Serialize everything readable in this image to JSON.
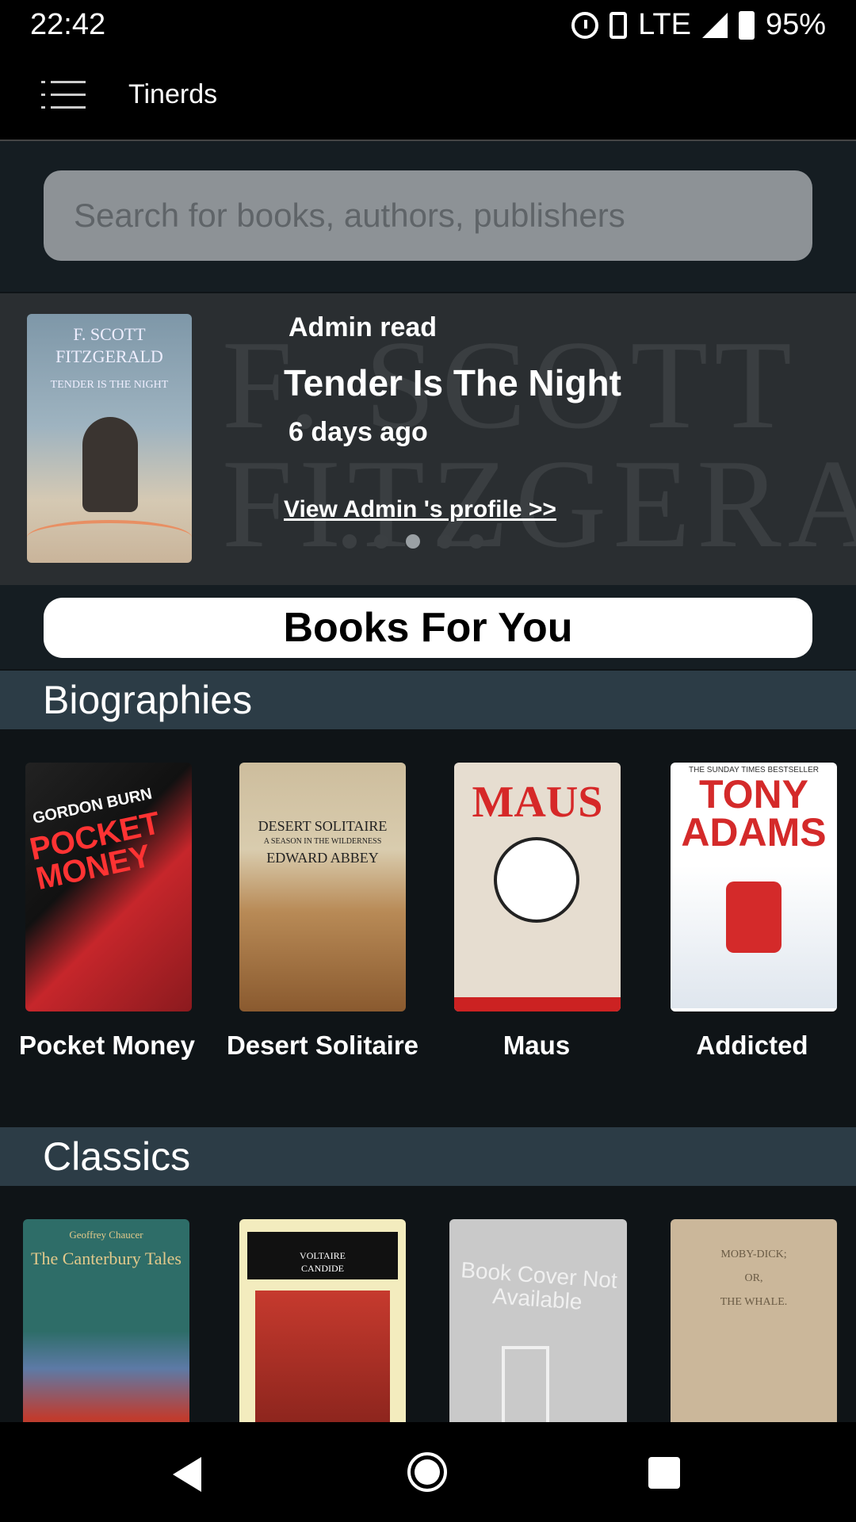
{
  "status_bar": {
    "time": "22:42",
    "network": "LTE",
    "battery": "95%"
  },
  "app_bar": {
    "title": "Tinerds"
  },
  "search": {
    "placeholder": "Search for books, authors, publishers"
  },
  "carousel": {
    "label": "Admin read",
    "title": "Tender Is The Night",
    "time_ago": "6 days ago",
    "profile_link": "View Admin 's profile >>",
    "background_text": "F. SCOTT FITZGERALD",
    "cover_author": "F. SCOTT FITZGERALD",
    "cover_title": "TENDER IS THE NIGHT",
    "dots": 5,
    "active_dot": 3
  },
  "books_for_you": {
    "label": "Books For You"
  },
  "categories": [
    {
      "name": "Biographies",
      "books": [
        {
          "title": "Pocket Money",
          "cover_text": [
            "GORDON BURN",
            "POCKET MONEY"
          ]
        },
        {
          "title": "Desert Solitaire",
          "cover_text": [
            "DESERT SOLITAIRE",
            "A SEASON IN THE WILDERNESS",
            "EDWARD ABBEY"
          ]
        },
        {
          "title": "Maus",
          "cover_text": [
            "MAUS"
          ]
        },
        {
          "title": "Addicted",
          "cover_text": [
            "THE SUNDAY TIMES BESTSELLER",
            "TONY ADAMS"
          ]
        }
      ]
    },
    {
      "name": "Classics",
      "books": [
        {
          "title": "The Canterbury Tales",
          "cover_text": [
            "Geoffrey Chaucer",
            "The Canterbury Tales"
          ]
        },
        {
          "title": "Candide",
          "cover_text": [
            "VOLTAIRE",
            "CANDIDE"
          ]
        },
        {
          "title": "Book Cover Not Available",
          "cover_text": [
            "Book Cover Not Available"
          ]
        },
        {
          "title": "Moby-Dick",
          "cover_text": [
            "MOBY-DICK;",
            "OR,",
            "THE WHALE."
          ]
        }
      ]
    }
  ],
  "colors": {
    "category_header": "#2c3c46",
    "app_bar": "#000000",
    "background": "#0f1417"
  }
}
